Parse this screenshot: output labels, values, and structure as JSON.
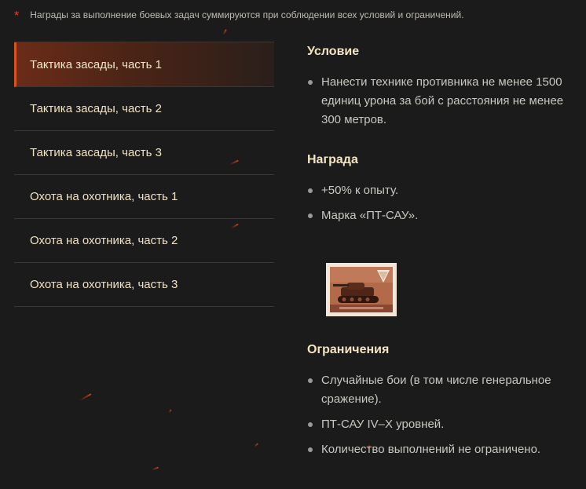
{
  "note": {
    "marker": "*",
    "text": "Награды за выполнение боевых задач суммируются при соблюдении всех условий и ограничений."
  },
  "tabs": [
    {
      "label": "Тактика засады, часть 1",
      "active": true
    },
    {
      "label": "Тактика засады, часть 2",
      "active": false
    },
    {
      "label": "Тактика засады, часть 3",
      "active": false
    },
    {
      "label": "Охота на охотника, часть 1",
      "active": false
    },
    {
      "label": "Охота на охотника, часть 2",
      "active": false
    },
    {
      "label": "Охота на охотника, часть 3",
      "active": false
    }
  ],
  "condition": {
    "title": "Условие",
    "items": [
      "Нанести технике противника не менее 1500 единиц урона за бой с расстояния не менее 300 метров."
    ]
  },
  "reward": {
    "title": "Награда",
    "items": [
      "+50% к опыту.",
      "Марка «ПТ-САУ»."
    ],
    "stamp_icon": "td-tank-stamp-icon"
  },
  "restrictions": {
    "title": "Ограничения",
    "items": [
      "Случайные бои (в том числе генеральное сражение).",
      "ПТ-САУ IV–X уровней.",
      "Количество выполнений не ограничено."
    ]
  },
  "colors": {
    "accent": "#d9511d",
    "background": "#1c1b1b",
    "title": "#f3e4c2"
  }
}
